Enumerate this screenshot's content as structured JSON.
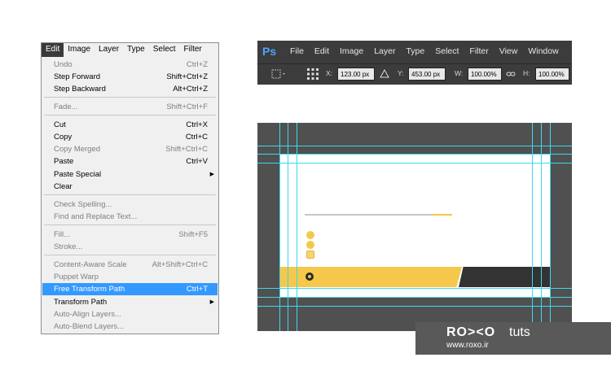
{
  "edit_menu": {
    "menubar": [
      "Edit",
      "Image",
      "Layer",
      "Type",
      "Select",
      "Filter"
    ],
    "items": [
      {
        "label": "Undo",
        "shortcut": "Ctrl+Z",
        "enabled": false
      },
      {
        "label": "Step Forward",
        "shortcut": "Shift+Ctrl+Z",
        "enabled": true
      },
      {
        "label": "Step Backward",
        "shortcut": "Alt+Ctrl+Z",
        "enabled": true
      },
      {
        "label": "Fade...",
        "shortcut": "Shift+Ctrl+F",
        "enabled": false
      },
      {
        "label": "Cut",
        "shortcut": "Ctrl+X",
        "enabled": true
      },
      {
        "label": "Copy",
        "shortcut": "Ctrl+C",
        "enabled": true
      },
      {
        "label": "Copy Merged",
        "shortcut": "Shift+Ctrl+C",
        "enabled": false
      },
      {
        "label": "Paste",
        "shortcut": "Ctrl+V",
        "enabled": true
      },
      {
        "label": "Paste Special",
        "shortcut": "",
        "enabled": true,
        "submenu": true
      },
      {
        "label": "Clear",
        "shortcut": "",
        "enabled": true
      },
      {
        "label": "Check Spelling...",
        "shortcut": "",
        "enabled": false
      },
      {
        "label": "Find and Replace Text...",
        "shortcut": "",
        "enabled": false
      },
      {
        "label": "Fill...",
        "shortcut": "Shift+F5",
        "enabled": false
      },
      {
        "label": "Stroke...",
        "shortcut": "",
        "enabled": false
      },
      {
        "label": "Content-Aware Scale",
        "shortcut": "Alt+Shift+Ctrl+C",
        "enabled": false
      },
      {
        "label": "Puppet Warp",
        "shortcut": "",
        "enabled": false
      },
      {
        "label": "Free Transform Path",
        "shortcut": "Ctrl+T",
        "enabled": true,
        "highlighted": true
      },
      {
        "label": "Transform Path",
        "shortcut": "",
        "enabled": true,
        "submenu": true
      },
      {
        "label": "Auto-Align Layers...",
        "shortcut": "",
        "enabled": false
      },
      {
        "label": "Auto-Blend Layers...",
        "shortcut": "",
        "enabled": false
      }
    ]
  },
  "ps_toolbar": {
    "logo": "Ps",
    "menu": [
      "File",
      "Edit",
      "Image",
      "Layer",
      "Type",
      "Select",
      "Filter",
      "View",
      "Window"
    ],
    "x_label": "X:",
    "x_value": "123.00 px",
    "y_label": "Y:",
    "y_value": "453.00 px",
    "w_label": "W:",
    "w_value": "100.00%",
    "h_label": "H:",
    "h_value": "100.00%"
  },
  "watermark": {
    "brand": "RO><O",
    "tuts": "tuts",
    "url": "www.roxo.ir"
  },
  "colors": {
    "accent_yellow": "#f5c84c",
    "dark": "#333333",
    "guide": "#39d9f0",
    "highlight": "#3399ff"
  }
}
